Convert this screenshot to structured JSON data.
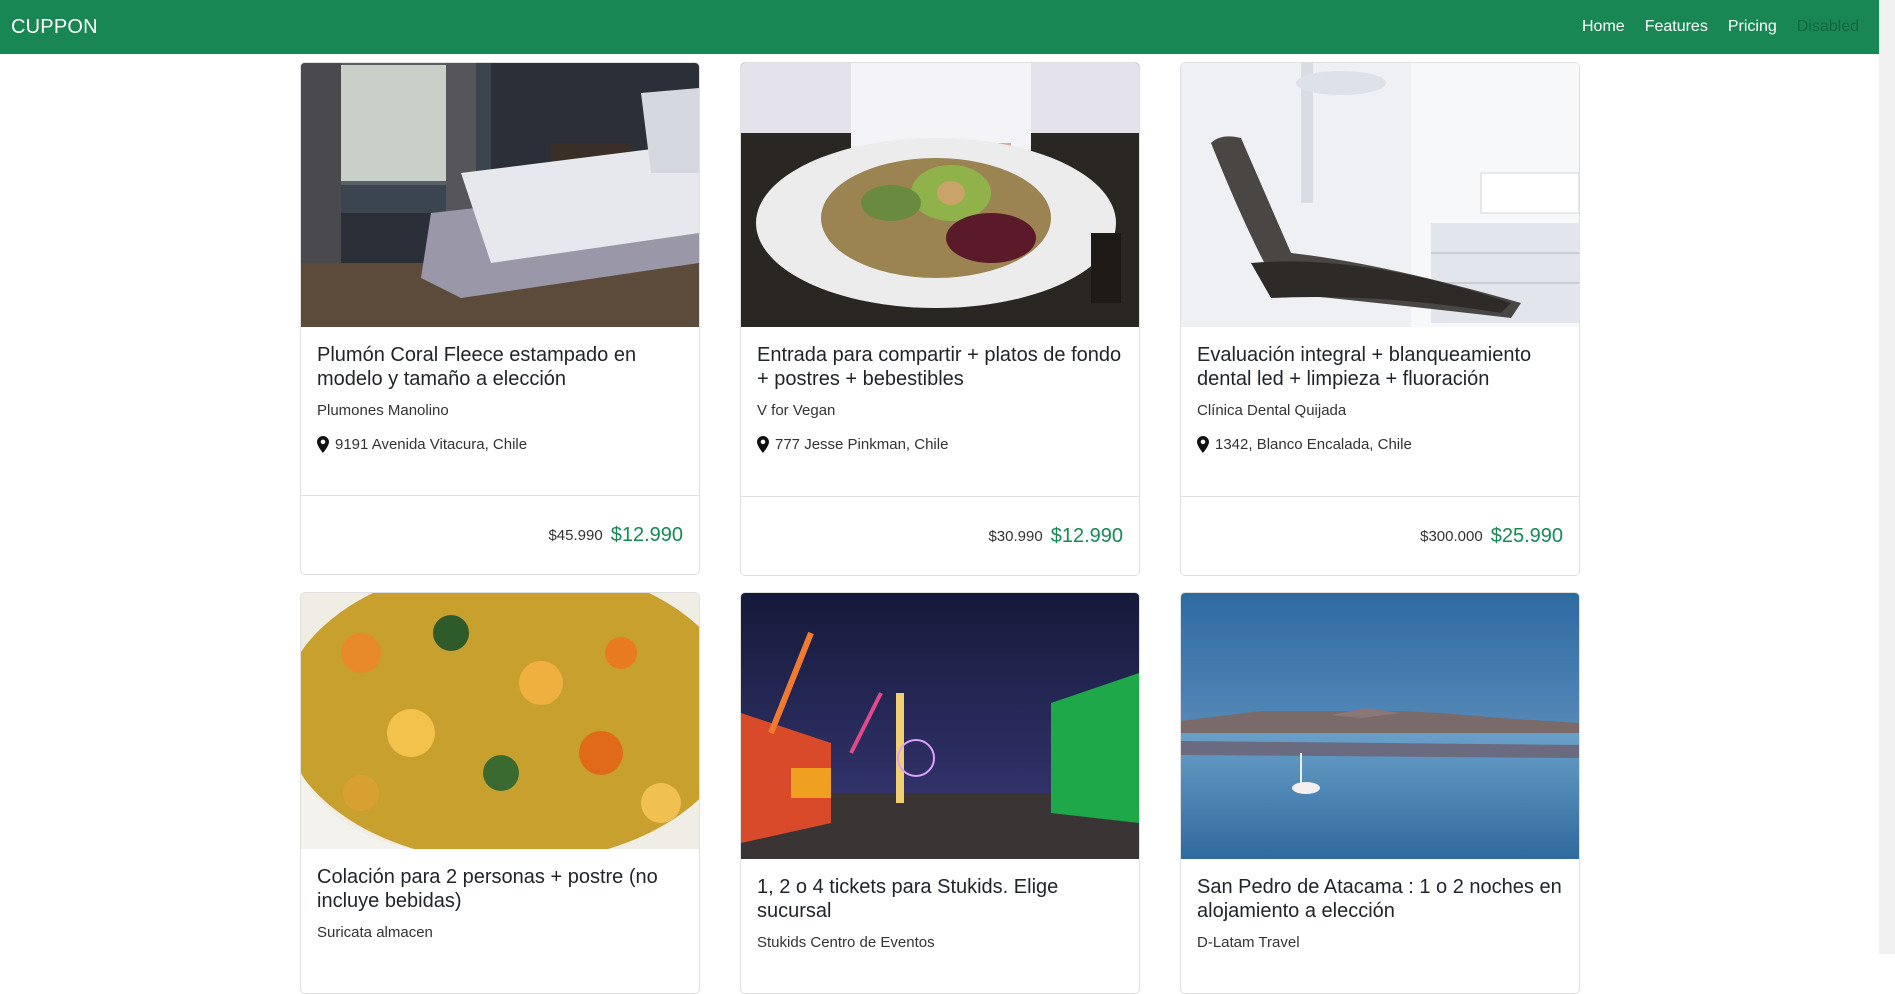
{
  "navbar": {
    "brand": "CUPPON",
    "links": [
      "Home",
      "Features",
      "Pricing",
      "Disabled"
    ]
  },
  "cards": [
    {
      "title": "Plumón Coral Fleece estampado en modelo y tamaño a elección",
      "merchant": "Plumones Manolino",
      "location": "9191 Avenida Vitacura, Chile",
      "old_price": "$45.990",
      "new_price": "$12.990",
      "image": "bedroom-photo"
    },
    {
      "title": "Entrada para compartir + platos de fondo + postres + bebestibles",
      "merchant": "V for Vegan",
      "location": "777 Jesse Pinkman, Chile",
      "old_price": "$30.990",
      "new_price": "$12.990",
      "image": "salad-plate-photo"
    },
    {
      "title": "Evaluación integral + blanqueamiento dental led + limpieza + fluoración",
      "merchant": "Clínica Dental Quijada",
      "location": "1342, Blanco Encalada, Chile",
      "old_price": "$300.000",
      "new_price": "$25.990",
      "image": "dental-chair-photo"
    },
    {
      "title": "Colación para 2 personas + postre (no incluye bebidas)",
      "merchant": "Suricata almacen",
      "image": "food-bowl-photo"
    },
    {
      "title": "1, 2 o 4 tickets para Stukids. Elige sucursal",
      "merchant": "Stukids Centro de Eventos",
      "image": "fair-night-photo"
    },
    {
      "title": "San Pedro de Atacama : 1 o 2 noches en alojamiento a elección",
      "merchant": "D-Latam Travel",
      "image": "flamingo-lake-photo"
    }
  ]
}
